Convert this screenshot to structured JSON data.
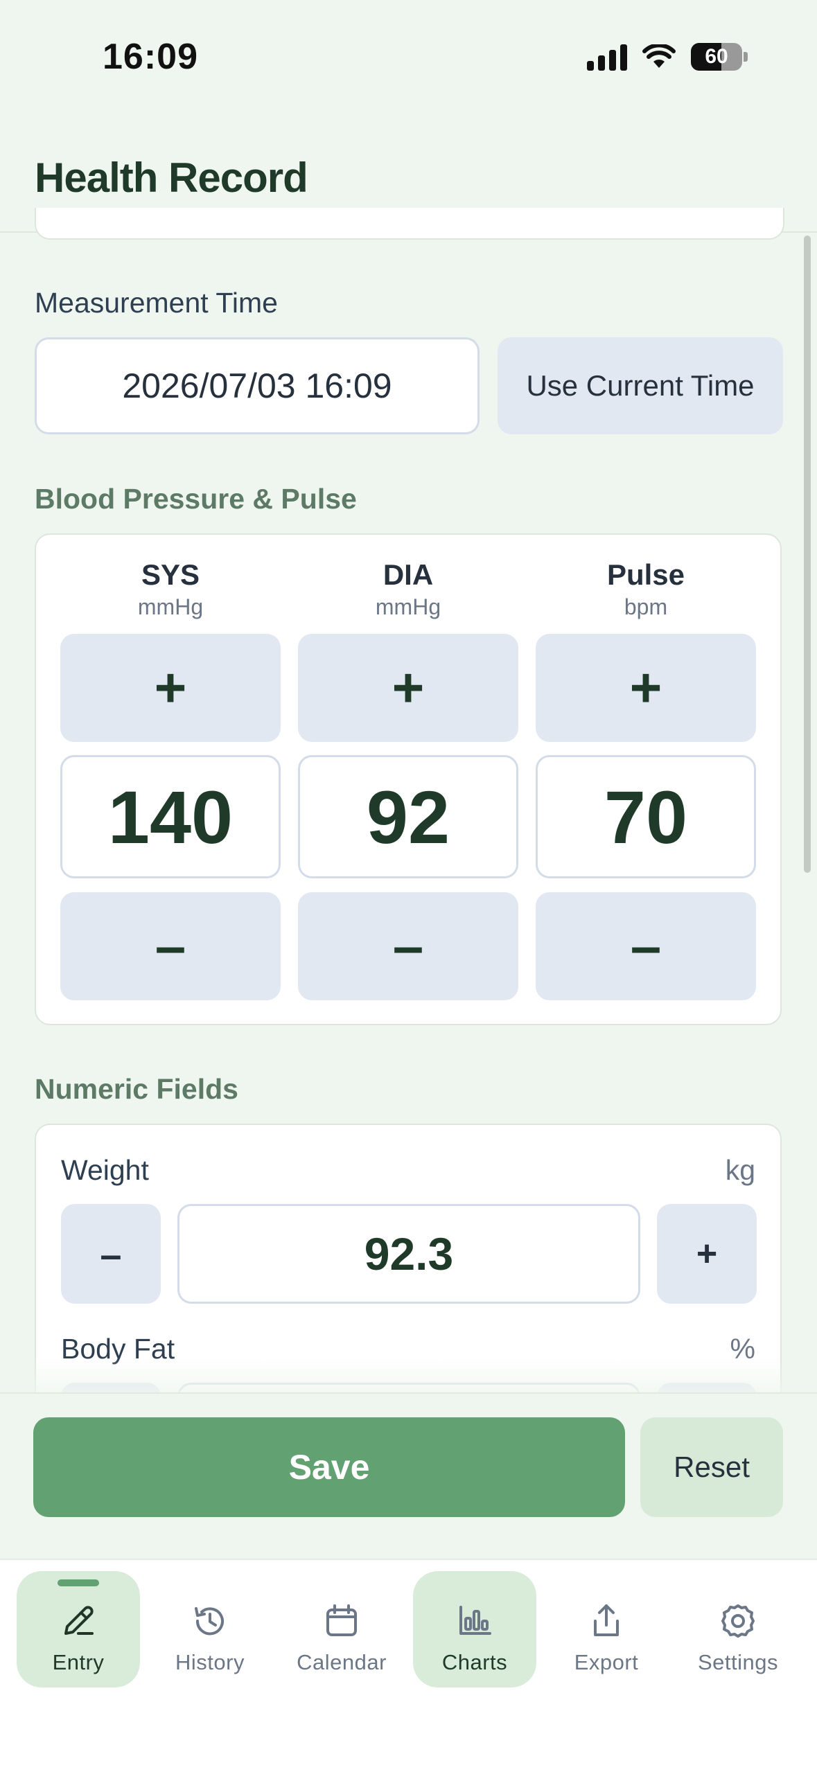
{
  "status_bar": {
    "time": "16:09",
    "battery": "60"
  },
  "header": {
    "title": "Health Record"
  },
  "measurement": {
    "label": "Measurement Time",
    "value": "2026/07/03 16:09",
    "use_current_label": "Use Current Time"
  },
  "bp_section": {
    "label": "Blood Pressure & Pulse",
    "plus": "+",
    "minus": "–",
    "columns": [
      {
        "title": "SYS",
        "unit": "mmHg",
        "value": "140"
      },
      {
        "title": "DIA",
        "unit": "mmHg",
        "value": "92"
      },
      {
        "title": "Pulse",
        "unit": "bpm",
        "value": "70"
      }
    ]
  },
  "numeric_section": {
    "label": "Numeric Fields",
    "fields": [
      {
        "label": "Weight",
        "unit": "kg",
        "value": "92.3",
        "minus": "–",
        "plus": "+"
      },
      {
        "label": "Body Fat",
        "unit": "%"
      }
    ]
  },
  "actions": {
    "save_label": "Save",
    "reset_label": "Reset"
  },
  "tabs": [
    {
      "label": "Entry",
      "icon": "pencil-icon"
    },
    {
      "label": "History",
      "icon": "history-icon"
    },
    {
      "label": "Calendar",
      "icon": "calendar-icon"
    },
    {
      "label": "Charts",
      "icon": "bar-chart-icon"
    },
    {
      "label": "Export",
      "icon": "share-icon"
    },
    {
      "label": "Settings",
      "icon": "gear-icon"
    }
  ],
  "colors": {
    "accent": "#62a272",
    "background": "#eff6ef",
    "button_gray": "#e1e8f1"
  }
}
